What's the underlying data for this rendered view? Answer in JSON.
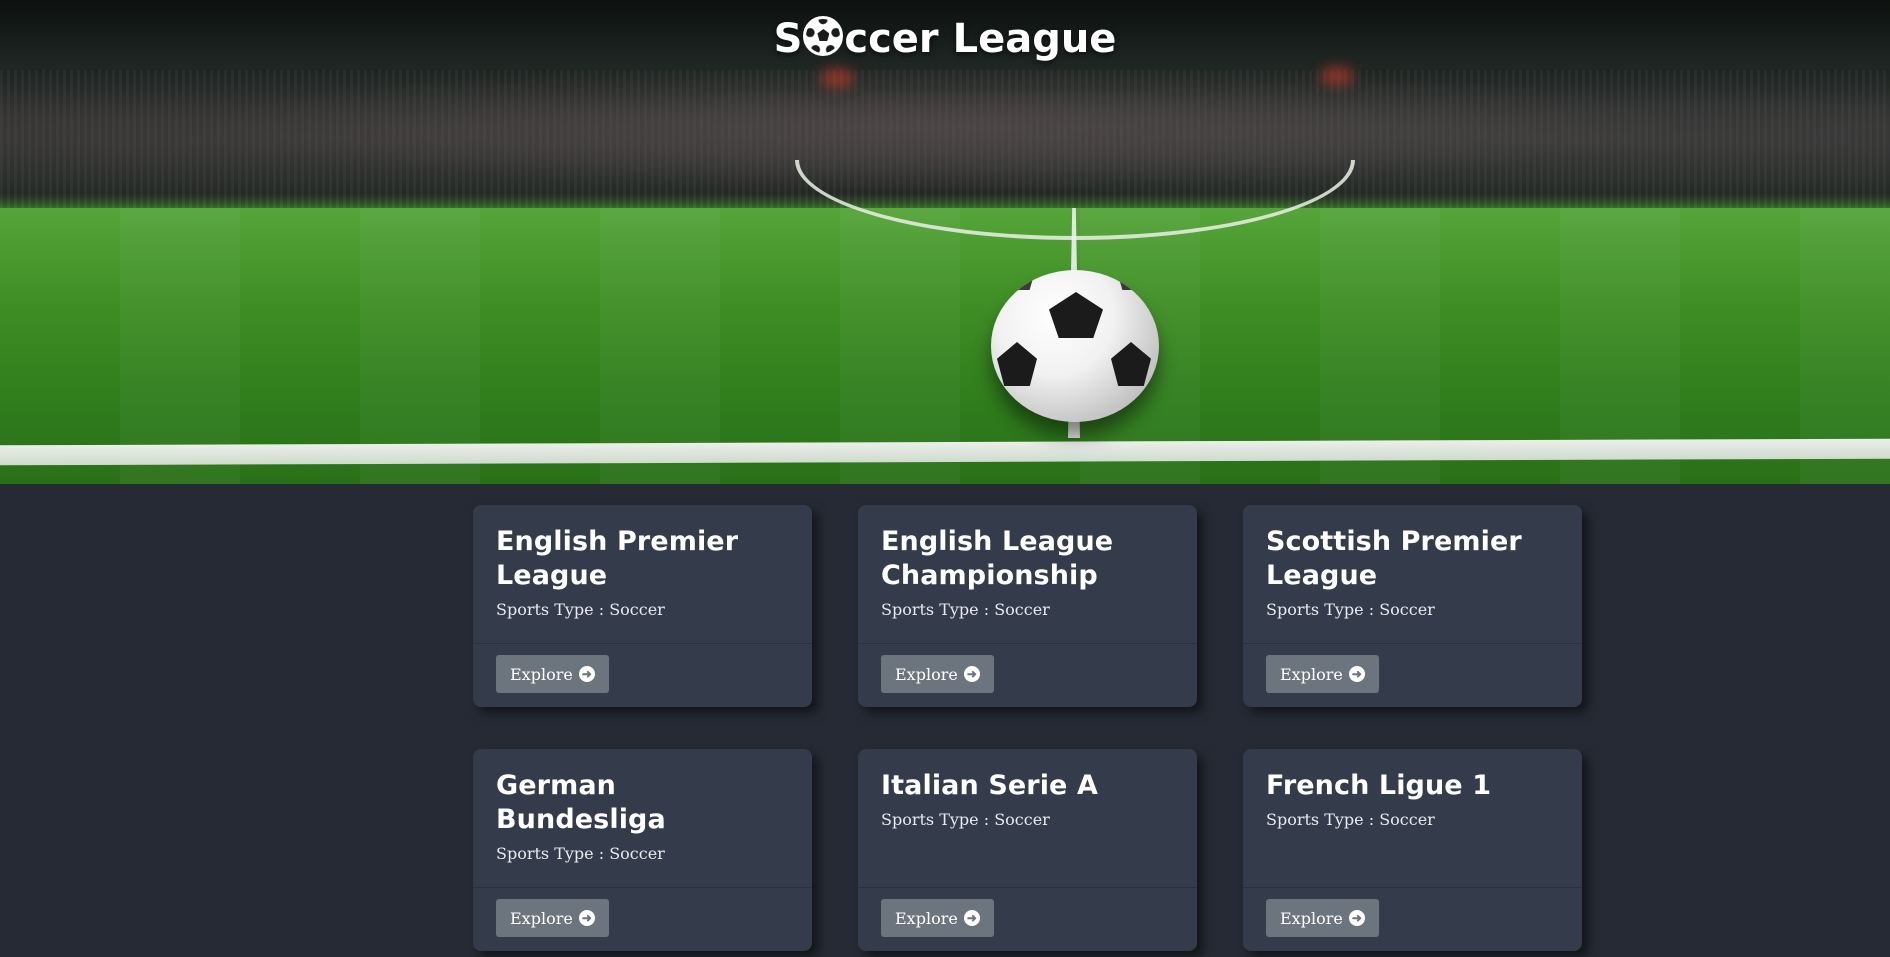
{
  "header": {
    "title_prefix": "S",
    "title_suffix": "ccer League",
    "title_ball_icon": "soccer-ball-icon"
  },
  "hero": {
    "image": "stadium-pitch-with-soccer-ball",
    "colors": {
      "grass": "#3f8e25",
      "lines": "#f0f0f0"
    }
  },
  "cards": [
    {
      "title": "English Premier League",
      "subtitle": "Sports Type : Soccer",
      "button_label": "Explore",
      "button_icon": "arrow-circle-right-icon"
    },
    {
      "title": "English League Championship",
      "subtitle": "Sports Type : Soccer",
      "button_label": "Explore",
      "button_icon": "arrow-circle-right-icon"
    },
    {
      "title": "Scottish Premier League",
      "subtitle": "Sports Type : Soccer",
      "button_label": "Explore",
      "button_icon": "arrow-circle-right-icon"
    },
    {
      "title": "German Bundesliga",
      "subtitle": "Sports Type : Soccer",
      "button_label": "Explore",
      "button_icon": "arrow-circle-right-icon"
    },
    {
      "title": "Italian Serie A",
      "subtitle": "Sports Type : Soccer",
      "button_label": "Explore",
      "button_icon": "arrow-circle-right-icon"
    },
    {
      "title": "French Ligue 1",
      "subtitle": "Sports Type : Soccer",
      "button_label": "Explore",
      "button_icon": "arrow-circle-right-icon"
    }
  ],
  "theme": {
    "page_background": "#252a34",
    "card_background": "#343c4b",
    "button_background": "#6c757d",
    "text": "#ffffff"
  }
}
